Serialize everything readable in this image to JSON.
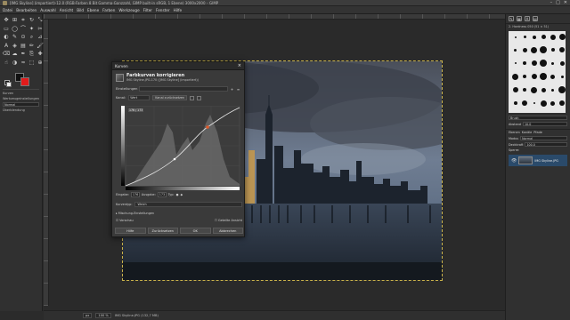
{
  "window": {
    "title": "[IMG Skyline] (importiert)-12.0 (RGB-Farben 8 Bit Gamma-Ganzzahl, GIMP built-in sRGB, 1 Ebene) 3000x2000 – GIMP",
    "controls": [
      "–",
      "□",
      "✕"
    ]
  },
  "menu": [
    "Datei",
    "Bearbeiten",
    "Auswahl",
    "Ansicht",
    "Bild",
    "Ebene",
    "Farben",
    "Werkzeuge",
    "Filter",
    "Fenster",
    "Hilfe"
  ],
  "toolbox": {
    "tool_icons": [
      "move-icon",
      "align-icon",
      "crop-icon",
      "rotate-icon",
      "scale-icon",
      "rect-select-icon",
      "ellipse-select-icon",
      "free-select-icon",
      "fuzzy-select-icon",
      "scissors-icon",
      "foreground-select-icon",
      "paths-icon",
      "color-picker-icon",
      "zoom-icon",
      "measure-icon",
      "text-icon",
      "bucket-fill-icon",
      "gradient-icon",
      "pencil-icon",
      "paintbrush-icon",
      "eraser-icon",
      "airbrush-icon",
      "ink-icon",
      "clone-icon",
      "heal-icon",
      "smudge-icon",
      "dodge-icon",
      "warp-icon",
      "unified-transform-icon",
      "handle-transform-icon"
    ],
    "tool_glyphs": [
      "✥",
      "⊞",
      "⌗",
      "↻",
      "⤡",
      "▭",
      "◯",
      "⌒",
      "✦",
      "✂",
      "◐",
      "✎",
      "⊙",
      "⌕",
      "⊿",
      "A",
      "◈",
      "▤",
      "✏",
      "🖌",
      "⌫",
      "☁",
      "✒",
      "⎘",
      "✚",
      "☝",
      "◑",
      "≈",
      "⬚",
      "⊕"
    ],
    "options_title": "Kurven",
    "options_rows": [
      "Werkzeugeinstellungen",
      "Modus",
      "Überblendung"
    ],
    "mode_value": "Normal"
  },
  "dialog": {
    "window_title": "Kurven",
    "heading": "Farbkurven korrigieren",
    "subheading": "IMG Skyline.JPG-170 ([IMG Skyline] (importiert))",
    "presets_label": "Einstellungen",
    "channel_label": "Kanal:",
    "channel_value": "Wert",
    "reset_channel": "Kanal zurücksetzen",
    "input_label": "Eingabe:",
    "input_value": "176",
    "output_label": "Ausgabe:",
    "output_value": "173",
    "type_label": "Typ:",
    "curve_type_label": "Kurventyp:",
    "curve_type_value": "Weich",
    "blend_label": "Mischung-Einstellungen",
    "preview_label": "Vorschau",
    "split_label": "Geteilte Ansicht",
    "tooltip": "176 / 173",
    "buttons": [
      "Hilfe",
      "Zurücksetzen",
      "OK",
      "Abbrechen"
    ]
  },
  "status": {
    "unit": "px",
    "zoom": "100 %",
    "text": "IMG Skyline.JPG (132,7 MB)"
  },
  "dock": {
    "tab_icons": [
      "brush-icon",
      "pattern-icon",
      "font-icon",
      "document-icon"
    ],
    "brush_name": "2. Hardness 050 (51 × 51)",
    "filter_label": "Brush",
    "spacing_label": "Abstand",
    "spacing_value": "10.0",
    "layers_tabs": [
      "Ebenen",
      "Kanäle",
      "Pfade"
    ],
    "mode_label": "Modus",
    "mode_value": "Normal",
    "opacity_label": "Deckkraft",
    "opacity_value": "100.0",
    "lock_label": "Sperre:",
    "layer_name": "IMG Skyline.JPG"
  }
}
